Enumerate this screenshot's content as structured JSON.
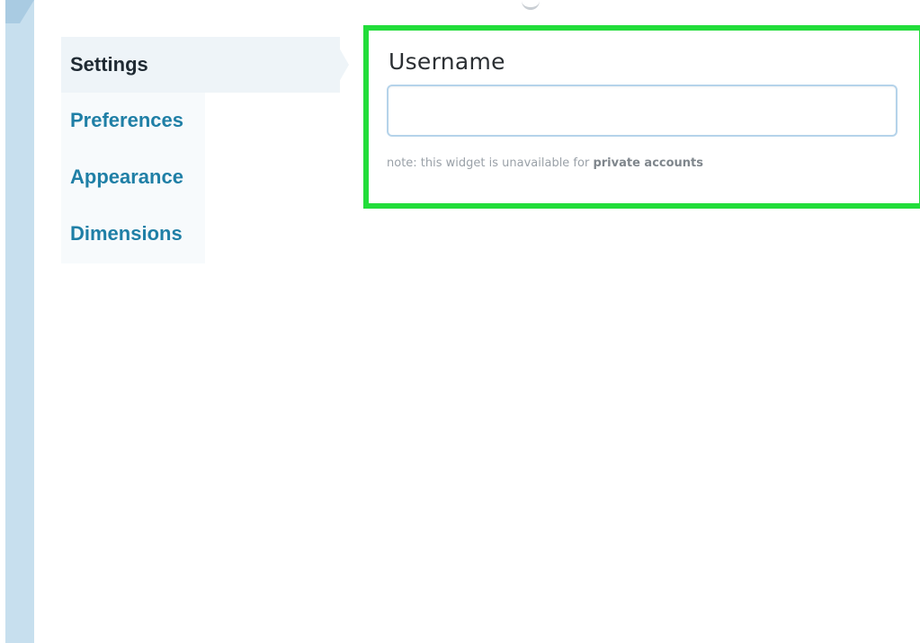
{
  "sidebar": {
    "items": [
      {
        "label": "Settings",
        "active": true
      },
      {
        "label": "Preferences",
        "active": false
      },
      {
        "label": "Appearance",
        "active": false
      },
      {
        "label": "Dimensions",
        "active": false
      }
    ]
  },
  "widget": {
    "field_label": "Username",
    "username_value": "",
    "note_prefix": "note: this widget is unavailable for ",
    "note_emphasis": "private accounts"
  },
  "colors": {
    "accent_link": "#1f7fa6",
    "highlight_border": "#22dd3a",
    "rail": "#c7dfee",
    "input_border": "#b5d3ea"
  }
}
